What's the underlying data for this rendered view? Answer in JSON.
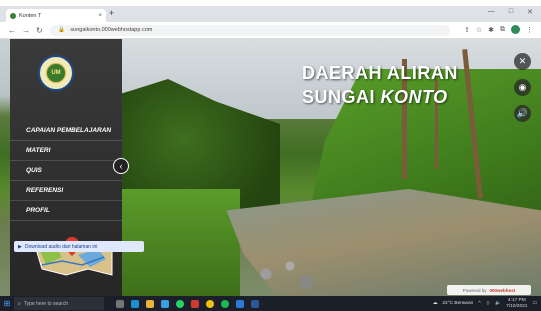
{
  "browser": {
    "tab_title": "Konten T",
    "tab_close": "×",
    "new_tab": "+",
    "url": "sungaikonto.000webhostapp.com",
    "window_controls": [
      "—",
      "□",
      "✕"
    ]
  },
  "hero": {
    "title_line1": "DAERAH ALIRAN",
    "title_line2_prefix": "SUNGAI ",
    "title_line2_em": "KONTO"
  },
  "sidebar": {
    "logo_text": "UM",
    "items": [
      {
        "label": "CAPAIAN PEMBELAJARAN"
      },
      {
        "label": "MATERI"
      },
      {
        "label": "QUIS"
      },
      {
        "label": "REFERENSI"
      },
      {
        "label": "PROFIL"
      }
    ],
    "collapse_glyph": "‹"
  },
  "right_controls": [
    {
      "icon": "close-icon",
      "glyph": "✕"
    },
    {
      "icon": "vr-icon",
      "glyph": "◉"
    },
    {
      "icon": "audio-icon",
      "glyph": "🔊"
    }
  ],
  "download": {
    "label": "Download audio dari halaman ini"
  },
  "powered": {
    "prefix": "Powered by",
    "brand": "000webhost"
  },
  "taskbar": {
    "search_placeholder": "Type here to search",
    "weather": "22°C Berawan",
    "time": "4:17 PM",
    "date": "7/10/2021"
  },
  "colors": {
    "accent_title": "#ffffff",
    "sidebar_bg": "#2b2b2b",
    "taskbar": "#1b1f2a"
  }
}
